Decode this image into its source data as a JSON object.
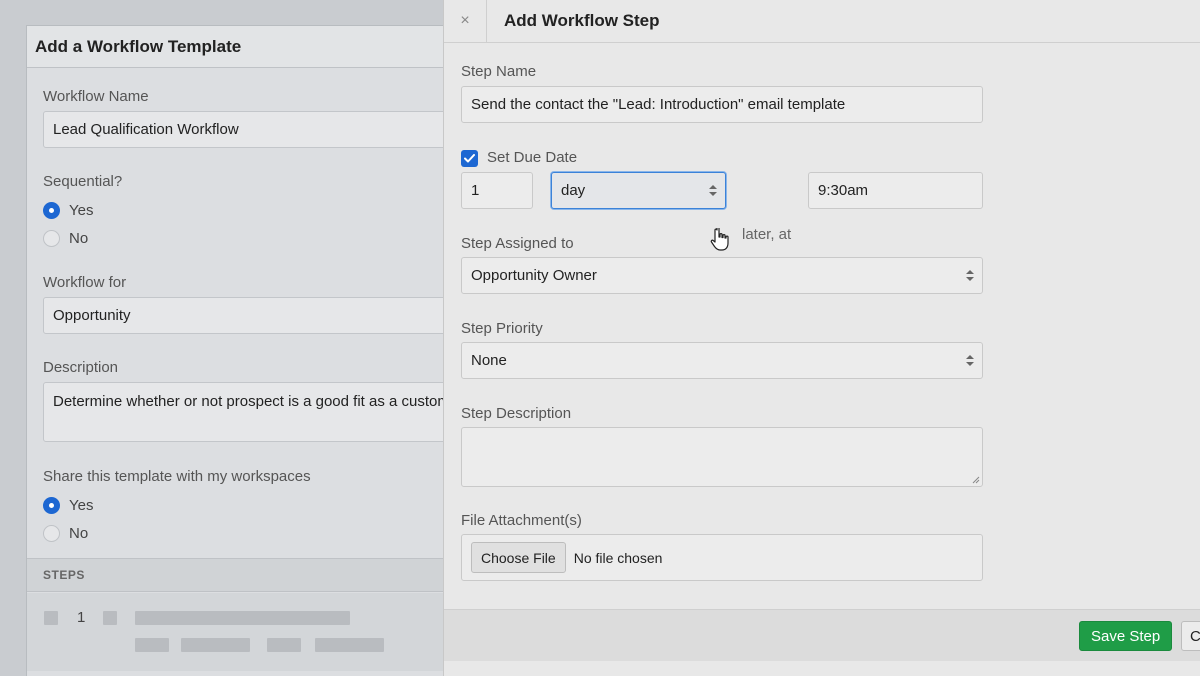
{
  "background": {
    "title": "Add a Workflow Template",
    "workflow_name": {
      "label": "Workflow Name",
      "value": "Lead Qualification Workflow"
    },
    "sequential": {
      "label": "Sequential?",
      "options": [
        "Yes",
        "No"
      ],
      "selected": "Yes"
    },
    "workflow_for": {
      "label": "Workflow for",
      "value": "Opportunity"
    },
    "description": {
      "label": "Description",
      "value": "Determine whether or not prospect is a good fit as a customer"
    },
    "share": {
      "label": "Share this template with my workspaces",
      "options": [
        "Yes",
        "No"
      ],
      "selected": "Yes"
    },
    "steps_header": "STEPS",
    "step_number": "1"
  },
  "modal": {
    "title": "Add Workflow Step",
    "close_glyph": "×",
    "step_name": {
      "label": "Step Name",
      "value": "Send the contact the \"Lead: Introduction\" email template"
    },
    "due_date": {
      "label": "Set Due Date",
      "checked": true,
      "amount": "1",
      "unit": "day",
      "later_text": "later, at",
      "time": "9:30am"
    },
    "assigned_to": {
      "label": "Step Assigned to",
      "value": "Opportunity Owner"
    },
    "priority": {
      "label": "Step Priority",
      "value": "None"
    },
    "description": {
      "label": "Step Description",
      "value": ""
    },
    "attachments": {
      "label": "File Attachment(s)",
      "button": "Choose File",
      "status": "No file chosen"
    },
    "save_label": "Save Step",
    "cancel_label": "Cancel"
  },
  "icons": {
    "close": "close-icon",
    "check": "check-icon",
    "select": "select-arrows-icon",
    "cursor": "hand-pointer-icon"
  },
  "colors": {
    "primary": "#1d67d2",
    "save": "#1f9d47"
  }
}
